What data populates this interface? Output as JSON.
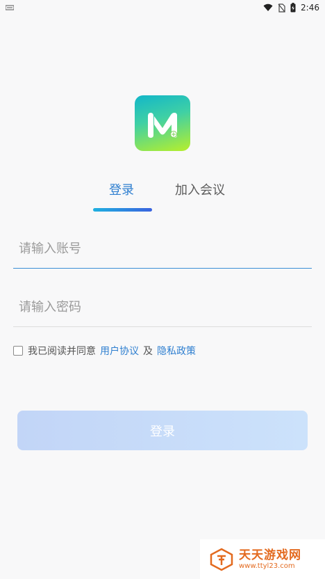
{
  "status_bar": {
    "time": "2:46",
    "icons": [
      "notification-icon",
      "wifi-icon",
      "no-sim-icon",
      "battery-charging-icon"
    ]
  },
  "logo": {
    "icon": "app-logo-icon",
    "colors": [
      "#12b6c9",
      "#3fd0a5",
      "#b7ef2b"
    ]
  },
  "tabs": [
    {
      "label": "登录",
      "active": true
    },
    {
      "label": "加入会议",
      "active": false
    }
  ],
  "form": {
    "account_placeholder": "请输入账号",
    "password_placeholder": "请输入密码"
  },
  "agreement": {
    "prefix": "我已阅读并同意",
    "user_agreement": "用户协议",
    "conjunction": "及",
    "privacy_policy": "隐私政策",
    "checked": false
  },
  "login_button": {
    "label": "登录"
  },
  "watermark": {
    "title": "天天游戏网",
    "url": "www.ttyl23.com"
  },
  "colors": {
    "accent": "#2f7fd0",
    "tab_indicator_start": "#1fb0e0",
    "tab_indicator_end": "#3a63df",
    "button_disabled": "#c2d5f7"
  }
}
